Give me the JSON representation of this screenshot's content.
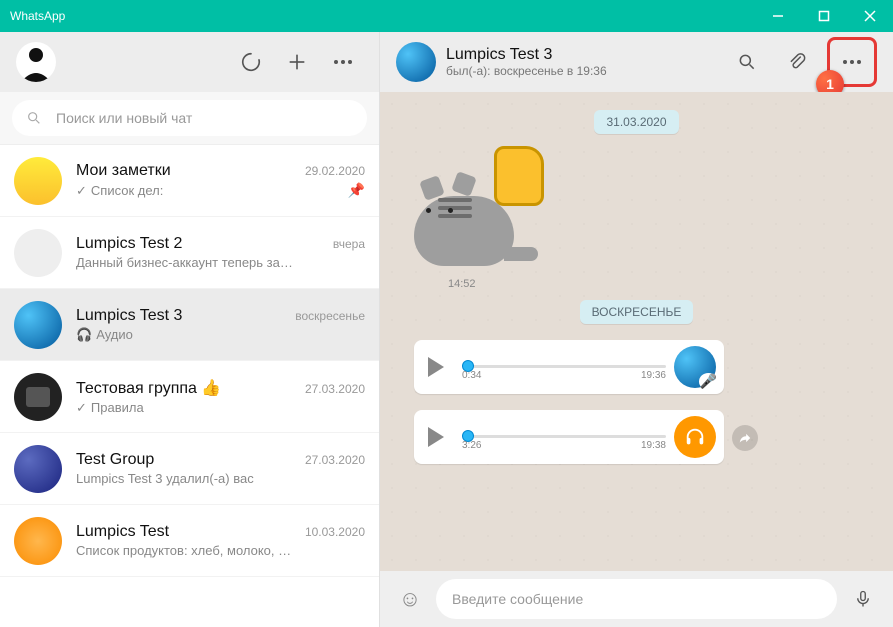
{
  "titlebar": {
    "app_name": "WhatsApp"
  },
  "sidebar": {
    "search_placeholder": "Поиск или новый чат",
    "items": [
      {
        "name": "Мои заметки",
        "time": "29.02.2020",
        "sub_prefix": "✓ ",
        "sub": "Список дел:",
        "pinned": true
      },
      {
        "name": "Lumpics Test 2",
        "time": "вчера",
        "sub": "Данный бизнес-аккаунт теперь за…"
      },
      {
        "name": "Lumpics Test 3",
        "time": "воскресенье",
        "sub": "Аудио",
        "audio_icon": true,
        "active": true
      },
      {
        "name": "Тестовая группа 👍",
        "time": "27.03.2020",
        "sub_prefix": "✓ ",
        "sub": "Правила"
      },
      {
        "name": "Test Group",
        "time": "27.03.2020",
        "sub": "Lumpics Test 3 удалил(-а) вас"
      },
      {
        "name": "Lumpics Test",
        "time": "10.03.2020",
        "sub": "Список продуктов: хлеб, молоко, …"
      }
    ]
  },
  "chat": {
    "title": "Lumpics Test 3",
    "subtitle": "был(-а): воскресенье в 19:36",
    "dates": {
      "d1": "31.03.2020",
      "d2": "ВОСКРЕСЕНЬЕ"
    },
    "sticker_time": "14:52",
    "voice": [
      {
        "duration": "0:34",
        "time": "19:36"
      },
      {
        "duration": "3:26",
        "time": "19:38"
      }
    ],
    "compose_placeholder": "Введите сообщение"
  },
  "callout": {
    "number": "1"
  },
  "colors": {
    "accent": "#00bfa5",
    "highlight": "#e53935"
  }
}
